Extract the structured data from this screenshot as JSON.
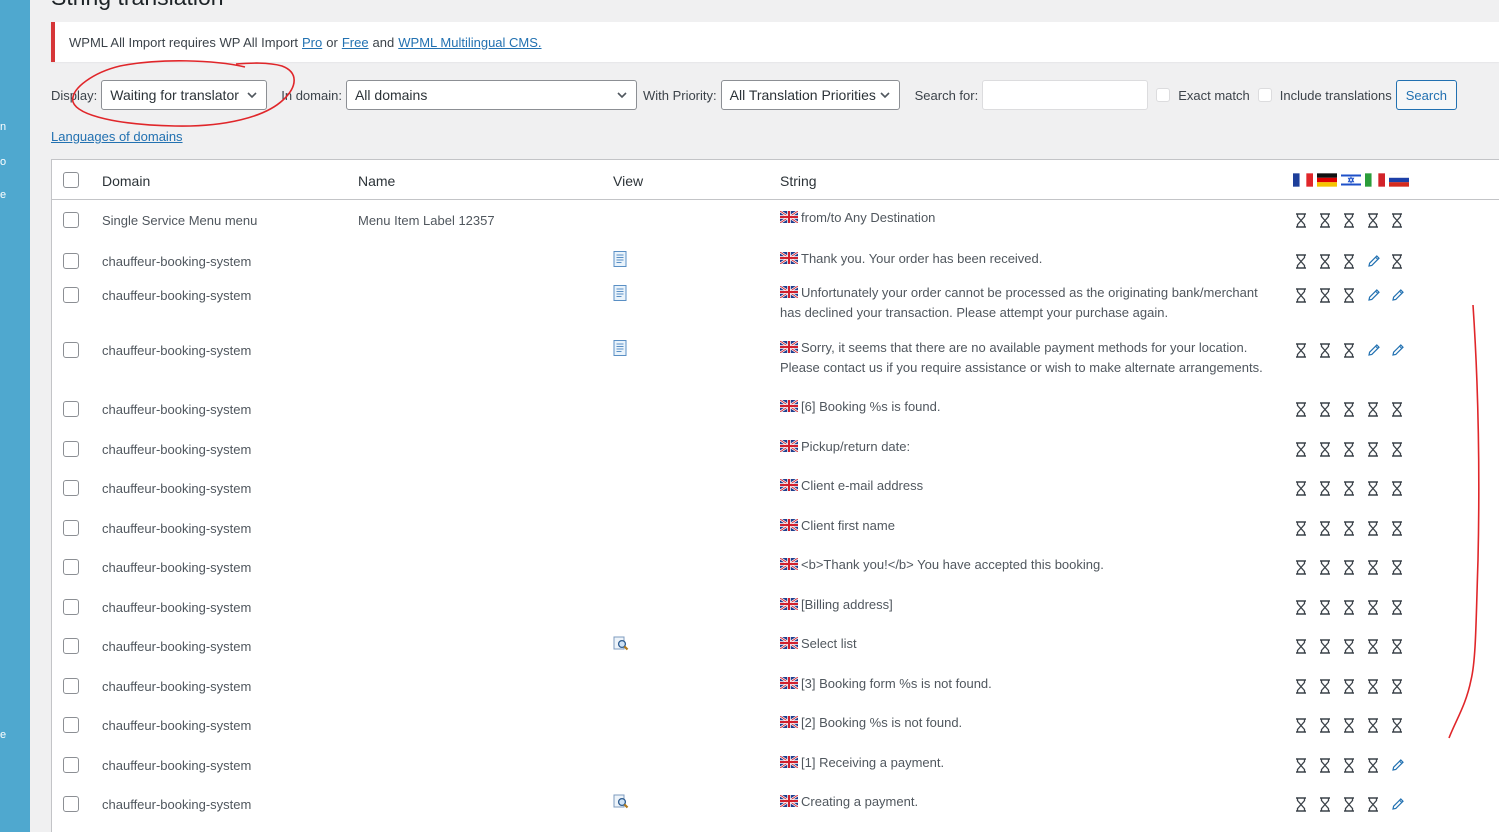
{
  "page": {
    "title": "String translation"
  },
  "sidebar": {
    "fragments": [
      "n",
      "o",
      "e",
      "e"
    ]
  },
  "notice": {
    "text_before": "WPML All Import requires WP All Import",
    "link_pro": "Pro",
    "text_or": "or",
    "link_free": "Free",
    "text_and": "and",
    "link_wpml": "WPML Multilingual CMS."
  },
  "filters": {
    "display_label": "Display:",
    "display_value": "Waiting for translator",
    "domain_label": "In domain:",
    "domain_value": "All domains",
    "priority_label": "With Priority:",
    "priority_value": "All Translation Priorities",
    "search_label": "Search for:",
    "search_value": "",
    "exact_match_label": "Exact match",
    "include_translations_label": "Include translations",
    "search_button": "Search"
  },
  "languages_link": "Languages of domains",
  "table": {
    "headers": {
      "domain": "Domain",
      "name": "Name",
      "view": "View",
      "string": "String"
    },
    "languages": [
      "fr",
      "de",
      "he",
      "it",
      "ru"
    ],
    "rows": [
      {
        "domain": "Single Service Menu menu",
        "name": "Menu Item Label 12357",
        "view": "",
        "string": "from/to Any Destination",
        "status": [
          "waiting",
          "waiting",
          "waiting",
          "waiting",
          "waiting"
        ]
      },
      {
        "domain": "chauffeur-booking-system",
        "name": "",
        "view": "page",
        "string": "Thank you. Your order has been received.",
        "status": [
          "waiting",
          "waiting",
          "waiting",
          "edit",
          "waiting"
        ]
      },
      {
        "domain": "chauffeur-booking-system",
        "name": "",
        "view": "page",
        "string": "Unfortunately your order cannot be processed as the originating bank/merchant has declined your transaction. Please attempt your purchase again.",
        "status": [
          "waiting",
          "waiting",
          "waiting",
          "edit",
          "edit"
        ]
      },
      {
        "domain": "chauffeur-booking-system",
        "name": "",
        "view": "page",
        "string": "Sorry, it seems that there are no available payment methods for your location. Please contact us if you require assistance or wish to make alternate arrangements.",
        "status": [
          "waiting",
          "waiting",
          "waiting",
          "edit",
          "edit"
        ]
      },
      {
        "domain": "chauffeur-booking-system",
        "name": "",
        "view": "",
        "string": "[6] Booking %s is found.",
        "status": [
          "waiting",
          "waiting",
          "waiting",
          "waiting",
          "waiting"
        ]
      },
      {
        "domain": "chauffeur-booking-system",
        "name": "",
        "view": "",
        "string": "Pickup/return date:",
        "status": [
          "waiting",
          "waiting",
          "waiting",
          "waiting",
          "waiting"
        ]
      },
      {
        "domain": "chauffeur-booking-system",
        "name": "",
        "view": "",
        "string": "Client e-mail address",
        "status": [
          "waiting",
          "waiting",
          "waiting",
          "waiting",
          "waiting"
        ]
      },
      {
        "domain": "chauffeur-booking-system",
        "name": "",
        "view": "",
        "string": "Client first name",
        "status": [
          "waiting",
          "waiting",
          "waiting",
          "waiting",
          "waiting"
        ]
      },
      {
        "domain": "chauffeur-booking-system",
        "name": "",
        "view": "",
        "string": "<b>Thank you!</b> You have accepted this booking.",
        "status": [
          "waiting",
          "waiting",
          "waiting",
          "waiting",
          "waiting"
        ]
      },
      {
        "domain": "chauffeur-booking-system",
        "name": "",
        "view": "",
        "string": "[Billing address]",
        "status": [
          "waiting",
          "waiting",
          "waiting",
          "waiting",
          "waiting"
        ]
      },
      {
        "domain": "chauffeur-booking-system",
        "name": "",
        "view": "search",
        "string": "Select list",
        "status": [
          "waiting",
          "waiting",
          "waiting",
          "waiting",
          "waiting"
        ]
      },
      {
        "domain": "chauffeur-booking-system",
        "name": "",
        "view": "",
        "string": "[3] Booking form %s is not found.",
        "status": [
          "waiting",
          "waiting",
          "waiting",
          "waiting",
          "waiting"
        ]
      },
      {
        "domain": "chauffeur-booking-system",
        "name": "",
        "view": "",
        "string": "[2] Booking %s is not found.",
        "status": [
          "waiting",
          "waiting",
          "waiting",
          "waiting",
          "waiting"
        ]
      },
      {
        "domain": "chauffeur-booking-system",
        "name": "",
        "view": "",
        "string": "[1] Receiving a payment.",
        "status": [
          "waiting",
          "waiting",
          "waiting",
          "waiting",
          "edit"
        ]
      },
      {
        "domain": "chauffeur-booking-system",
        "name": "",
        "view": "search",
        "string": "Creating a payment.",
        "status": [
          "waiting",
          "waiting",
          "waiting",
          "waiting",
          "edit"
        ]
      }
    ]
  },
  "colors": {
    "accent": "#2271b1",
    "sidebar": "#4fa8cf",
    "annotation": "#e0262a",
    "notice_error": "#d63638"
  }
}
